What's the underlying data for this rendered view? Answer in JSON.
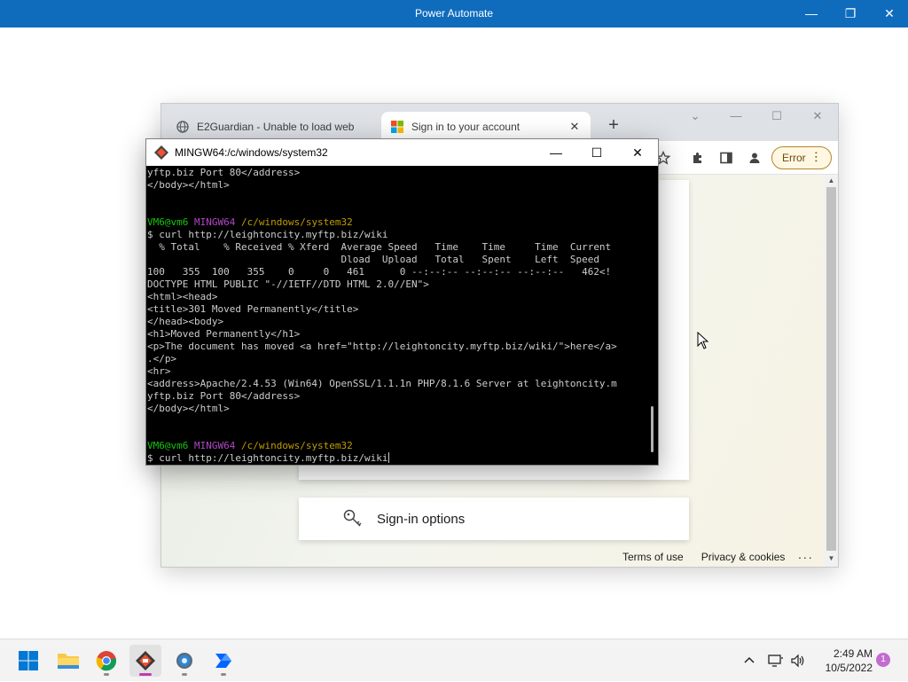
{
  "app_window": {
    "title": "Power Automate",
    "minimize_glyph": "—",
    "restore_glyph": "❐",
    "close_glyph": "✕"
  },
  "browser": {
    "tabs": [
      {
        "label": "E2Guardian - Unable to load web",
        "icon": "globe-icon",
        "close": "✕"
      },
      {
        "label": "Sign in to your account",
        "icon": "microsoft-logo-icon",
        "close": "✕"
      }
    ],
    "new_tab": "+",
    "error_label": "Error",
    "signin_options": "Sign-in options",
    "footer": {
      "terms": "Terms of use",
      "privacy": "Privacy & cookies",
      "more": "..."
    },
    "colors": {
      "microsoft_red": "#f25022",
      "microsoft_green": "#7fba00",
      "microsoft_blue": "#00a4ef",
      "microsoft_yellow": "#ffb900"
    }
  },
  "terminal": {
    "title": "MINGW64:/c/windows/system32",
    "lines": [
      {
        "segments": [
          {
            "text": "yftp.biz Port 80</address>",
            "color": ""
          }
        ]
      },
      {
        "segments": [
          {
            "text": "</body></html>",
            "color": ""
          }
        ]
      },
      {
        "segments": [
          {
            "text": "",
            "color": ""
          }
        ]
      },
      {
        "segments": [
          {
            "text": "",
            "color": ""
          }
        ]
      },
      {
        "segments": [
          {
            "text": "VM6@vm6 ",
            "color": "green"
          },
          {
            "text": "MINGW64 ",
            "color": "magenta"
          },
          {
            "text": "/c/windows/system32",
            "color": "yellow"
          }
        ]
      },
      {
        "segments": [
          {
            "text": "$ curl http://leightoncity.myftp.biz/wiki",
            "color": ""
          }
        ]
      },
      {
        "segments": [
          {
            "text": "  % Total    % Received % Xferd  Average Speed   Time    Time     Time  Current",
            "color": ""
          }
        ]
      },
      {
        "segments": [
          {
            "text": "                                 Dload  Upload   Total   Spent    Left  Speed",
            "color": ""
          }
        ]
      },
      {
        "segments": [
          {
            "text": "100   355  100   355    0     0   461      0 --:--:-- --:--:-- --:--:--   462<!",
            "color": ""
          }
        ]
      },
      {
        "segments": [
          {
            "text": "DOCTYPE HTML PUBLIC \"-//IETF//DTD HTML 2.0//EN\">",
            "color": ""
          }
        ]
      },
      {
        "segments": [
          {
            "text": "<html><head>",
            "color": ""
          }
        ]
      },
      {
        "segments": [
          {
            "text": "<title>301 Moved Permanently</title>",
            "color": ""
          }
        ]
      },
      {
        "segments": [
          {
            "text": "</head><body>",
            "color": ""
          }
        ]
      },
      {
        "segments": [
          {
            "text": "<h1>Moved Permanently</h1>",
            "color": ""
          }
        ]
      },
      {
        "segments": [
          {
            "text": "<p>The document has moved <a href=\"http://leightoncity.myftp.biz/wiki/\">here</a>",
            "color": ""
          }
        ]
      },
      {
        "segments": [
          {
            "text": ".</p>",
            "color": ""
          }
        ]
      },
      {
        "segments": [
          {
            "text": "<hr>",
            "color": ""
          }
        ]
      },
      {
        "segments": [
          {
            "text": "<address>Apache/2.4.53 (Win64) OpenSSL/1.1.1n PHP/8.1.6 Server at leightoncity.m",
            "color": ""
          }
        ]
      },
      {
        "segments": [
          {
            "text": "yftp.biz Port 80</address>",
            "color": ""
          }
        ]
      },
      {
        "segments": [
          {
            "text": "</body></html>",
            "color": ""
          }
        ]
      },
      {
        "segments": [
          {
            "text": "",
            "color": ""
          }
        ]
      },
      {
        "segments": [
          {
            "text": "",
            "color": ""
          }
        ]
      },
      {
        "segments": [
          {
            "text": "VM6@vm6 ",
            "color": "green"
          },
          {
            "text": "MINGW64 ",
            "color": "magenta"
          },
          {
            "text": "/c/windows/system32",
            "color": "yellow"
          }
        ]
      }
    ],
    "current_command": "$ curl http://leightoncity.myftp.biz/wiki",
    "colors": {
      "green": "#16c60c",
      "magenta": "#b148c6",
      "yellow": "#c19c00",
      "background": "#000000",
      "text": "#cccccc"
    }
  },
  "taskbar": {
    "apps": [
      {
        "name": "start-button",
        "icon": "windows-logo-icon",
        "active": false
      },
      {
        "name": "file-explorer",
        "icon": "folder-icon",
        "active": false
      },
      {
        "name": "chrome",
        "icon": "chrome-icon",
        "active": false
      },
      {
        "name": "git-bash",
        "icon": "git-bash-icon",
        "active": true
      },
      {
        "name": "settings",
        "icon": "gear-icon",
        "active": false
      },
      {
        "name": "power-automate",
        "icon": "power-automate-icon",
        "active": false
      }
    ],
    "time": "2:49 AM",
    "date": "10/5/2022",
    "notification_count": "1",
    "tray_chevron": "^"
  }
}
